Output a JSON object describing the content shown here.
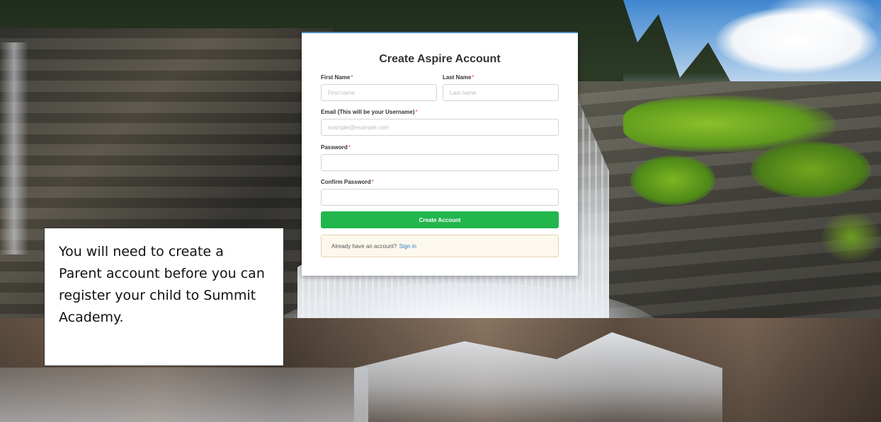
{
  "form": {
    "title": "Create Aspire Account",
    "first_name": {
      "label": "First Name",
      "required_mark": "*",
      "placeholder": "First name",
      "value": ""
    },
    "last_name": {
      "label": "Last Name",
      "required_mark": "*",
      "placeholder": "Last name",
      "value": ""
    },
    "email": {
      "label": "Email (This will be your Username)",
      "required_mark": "*",
      "placeholder": "example@example.com",
      "value": ""
    },
    "password": {
      "label": "Password",
      "required_mark": "*",
      "placeholder": "",
      "value": ""
    },
    "confirm_password": {
      "label": "Confirm Password",
      "required_mark": "*",
      "placeholder": "",
      "value": ""
    },
    "submit_label": "Create Account",
    "signin_prompt": "Already have an account?",
    "signin_link": "Sign in"
  },
  "callout": {
    "text": "You will need to create a Parent account before you can register your child to Summit Academy."
  },
  "colors": {
    "accent_green": "#22b64d",
    "link_blue": "#2f7ec4",
    "required_red": "#e03b3b"
  }
}
